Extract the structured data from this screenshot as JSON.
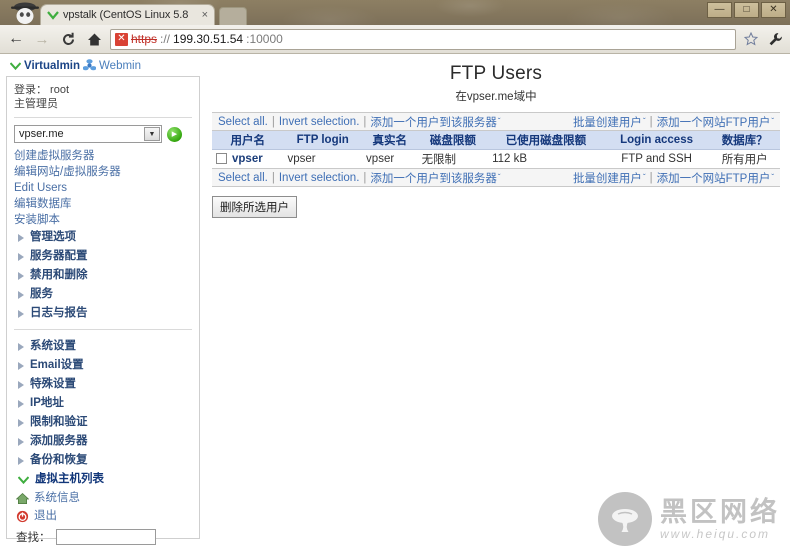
{
  "window": {
    "controls": [
      {
        "name": "minimize",
        "glyph": "—"
      },
      {
        "name": "maximize",
        "glyph": "□"
      },
      {
        "name": "close",
        "glyph": "✕"
      }
    ]
  },
  "browser": {
    "tab": {
      "title": "vpstalk (CentOS Linux 5.8",
      "close_glyph": "×"
    },
    "nav": {
      "back": "←",
      "forward": "→",
      "reload": "C",
      "home": "⌂"
    },
    "url": {
      "cert_badge": "✕",
      "scheme": "https",
      "separator": "://",
      "host": "199.30.51.54",
      "port": ":10000"
    }
  },
  "sidebar": {
    "brand": {
      "virtualmin": "Virtualmin",
      "webmin": "Webmin"
    },
    "login_label": "登录： root",
    "role_label": "主管理员",
    "domain_select": {
      "value": "vpser.me",
      "arrow_glyph": "▼",
      "go_glyph": "▶"
    },
    "links": [
      "创建虚拟服务器",
      "编辑网站/虚拟服务器",
      "Edit Users",
      "编辑数据库",
      "安装脚本"
    ],
    "groups_a": [
      "管理选项",
      "服务器配置",
      "禁用和删除",
      "服务",
      "日志与报告"
    ],
    "groups_b": [
      "系统设置",
      "Email设置",
      "特殊设置",
      "IP地址",
      "限制和验证",
      "添加服务器",
      "备份和恢复"
    ],
    "active_item": "虚拟主机列表",
    "system_info": "系统信息",
    "logout": "退出",
    "search_label": "查找：",
    "search_value": "",
    "search_placeholder": ""
  },
  "main": {
    "title": "FTP Users",
    "subtitle": "在vpser.me域中",
    "linkbar": {
      "select_all": "Select all.",
      "invert_selection": "Invert selection.",
      "add_user": "添加一个用户到该服务器",
      "batch_create": "批量创建用户",
      "add_web_ftp": "添加一个网站FTP用户",
      "separator": "|",
      "caret": "ˇ"
    },
    "table": {
      "columns": [
        "用户名",
        "FTP login",
        "真实名",
        "磁盘限额",
        "已使用磁盘限额",
        "Login access",
        "数据库？"
      ],
      "rows": [
        {
          "checked": false,
          "username": "vpser",
          "ftp_login": "vpser",
          "real_name": "vpser",
          "disk_quota": "无限制",
          "used_quota": "112 kB",
          "login_access": "FTP and SSH",
          "databases": "所有用户"
        }
      ]
    },
    "delete_button": "删除所选用户"
  },
  "watermark": {
    "cn": "黑区网络",
    "url": "www.heiqu.com"
  },
  "colors": {
    "accent_link": "#3f6fb5",
    "table_header_bg": "#d3def2",
    "table_header_text": "#15387c",
    "chrome_bg": "#7d7059",
    "error_red": "#c03028",
    "go_green": "#35a80f"
  }
}
